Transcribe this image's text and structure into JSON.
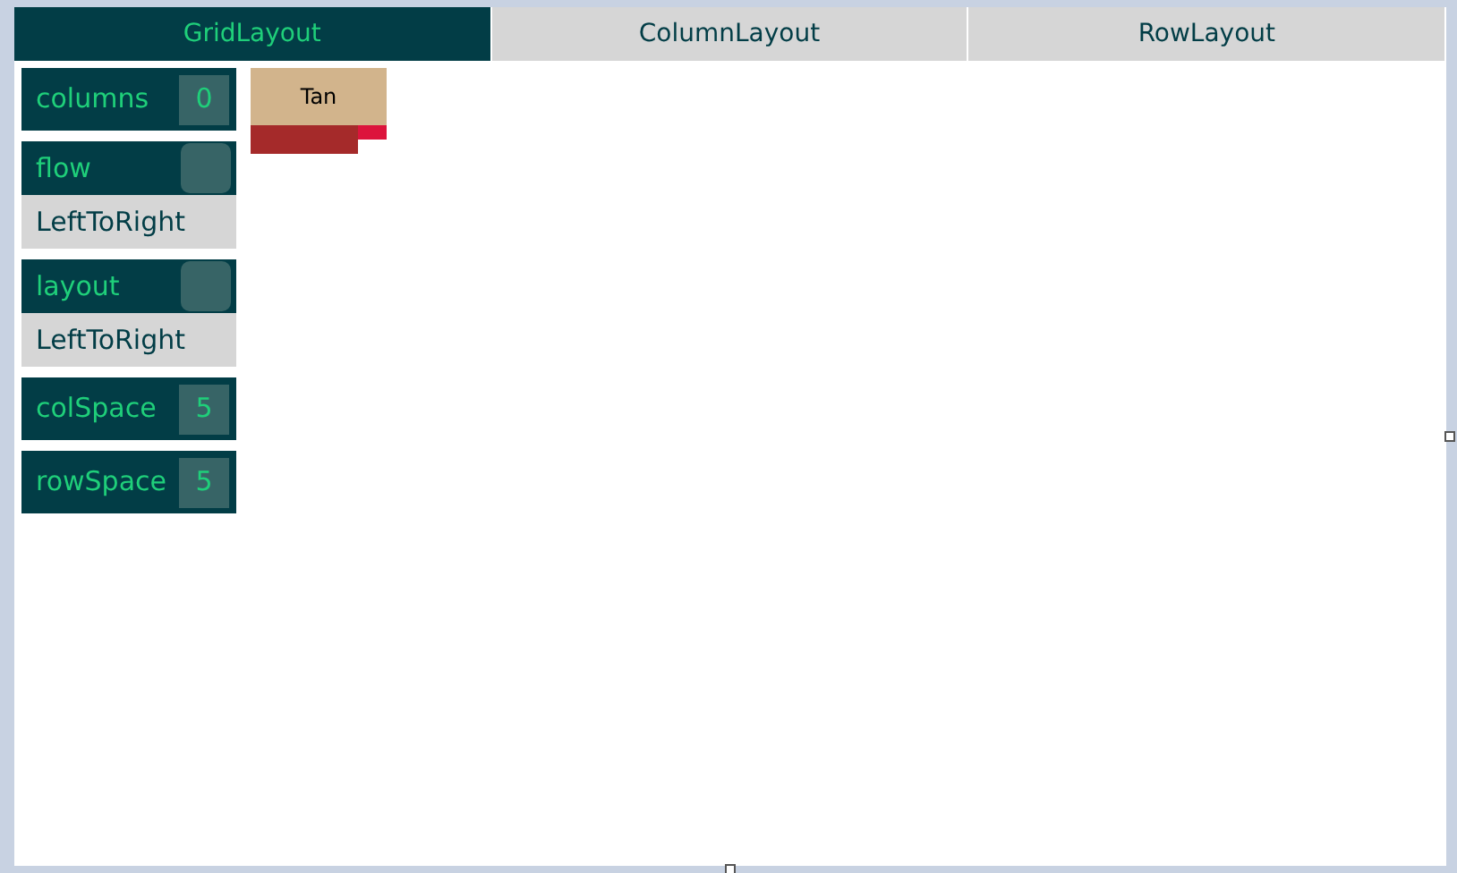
{
  "tabs": [
    {
      "label": "GridLayout",
      "selected": true
    },
    {
      "label": "ColumnLayout",
      "selected": false
    },
    {
      "label": "RowLayout",
      "selected": false
    }
  ],
  "controls": [
    {
      "kind": "number",
      "label": "columns",
      "value": "0"
    },
    {
      "kind": "select",
      "label": "flow",
      "value": "LeftToRight"
    },
    {
      "kind": "select",
      "label": "layout",
      "value": "LeftToRight"
    },
    {
      "kind": "number",
      "label": "colSpace",
      "value": "5"
    },
    {
      "kind": "number",
      "label": "rowSpace",
      "value": "5"
    }
  ],
  "preview": {
    "items": [
      {
        "label": "Tan"
      }
    ]
  }
}
